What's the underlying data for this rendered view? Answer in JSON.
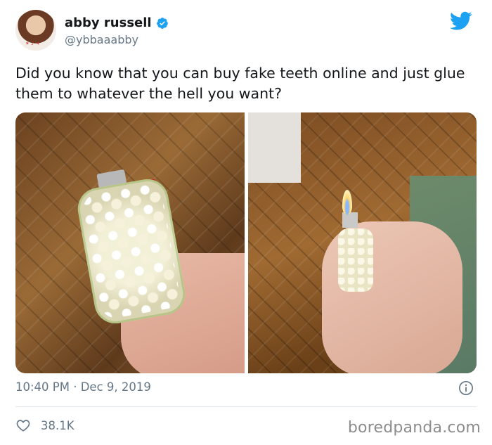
{
  "author": {
    "name": "abby russell",
    "handle": "@ybbaaabby",
    "verified_icon": "verified-badge-icon"
  },
  "tweet": {
    "text": "Did you know that you can buy fake teeth online and just glue them to whatever the hell you want?",
    "timestamp": "10:40 PM · Dec 9, 2019",
    "likes": "38.1K"
  },
  "watermark": "boredpanda.com",
  "colors": {
    "twitter_blue": "#1da1f2",
    "secondary_text": "#657786",
    "divider": "#e1e8ed"
  }
}
